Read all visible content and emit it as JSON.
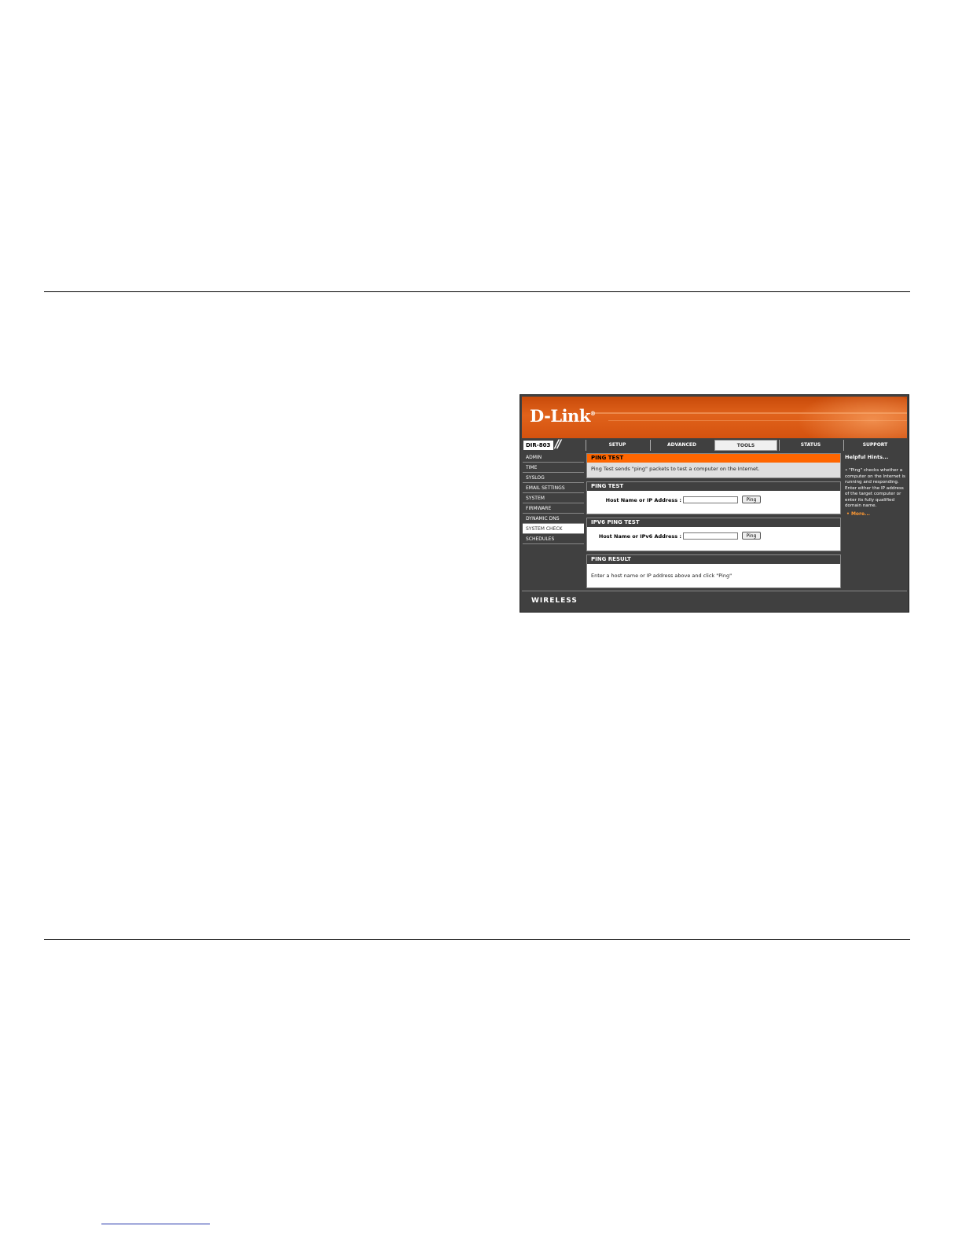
{
  "brand": {
    "logo": "D-Link",
    "model": "DIR-803",
    "footer": "WIRELESS"
  },
  "nav": {
    "tabs": [
      "SETUP",
      "ADVANCED",
      "TOOLS",
      "STATUS",
      "SUPPORT"
    ],
    "active": "TOOLS"
  },
  "sidebar": {
    "items": [
      "ADMIN",
      "TIME",
      "SYSLOG",
      "EMAIL SETTINGS",
      "SYSTEM",
      "FIRMWARE",
      "DYNAMIC DNS",
      "SYSTEM CHECK",
      "SCHEDULES"
    ],
    "active": "SYSTEM CHECK"
  },
  "ping_intro": {
    "title": "PING TEST",
    "description": "Ping Test sends \"ping\" packets to test a computer on the Internet."
  },
  "ping_test": {
    "title": "PING TEST",
    "label": "Host Name or IP Address :",
    "value": "",
    "button": "Ping"
  },
  "ipv6_ping_test": {
    "title": "IPV6 PING TEST",
    "label": "Host Name or IPv6 Address :",
    "value": "",
    "button": "Ping"
  },
  "ping_result": {
    "title": "PING RESULT",
    "text": "Enter a host name or IP address above and click \"Ping\""
  },
  "hints": {
    "title": "Helpful Hints...",
    "text": "\"Ping\" checks whether a computer on the Internet is running and responding. Enter either the IP address of the target computer or enter its fully qualified domain name.",
    "more": "More..."
  },
  "colors": {
    "accent": "#ff6600",
    "banner": "#d4520f",
    "dark": "#404040",
    "link": "#ff9933"
  }
}
